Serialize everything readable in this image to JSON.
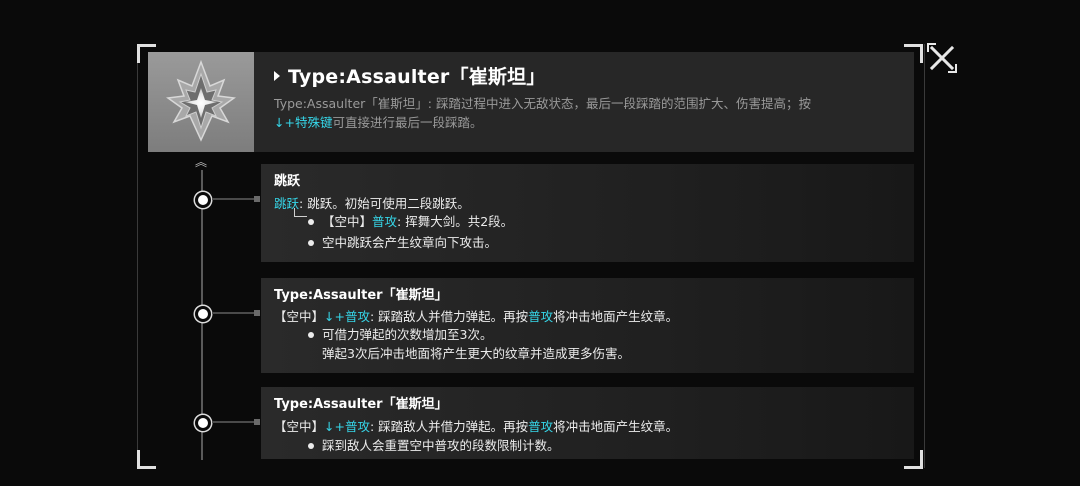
{
  "header": {
    "title": "Type:Assaulter「崔斯坦」",
    "desc_prefix": "Type:Assaulter「崔斯坦」: 踩踏过程中进入无敌状态，最后一段踩踏的范围扩大、伤害提高；按",
    "desc_key": "↓+特殊键",
    "desc_suffix": "可直接进行最后一段踩踏。"
  },
  "cards": [
    {
      "title": "跳跃",
      "line1_key": "跳跃",
      "line1_text": ": 跳跃。初始可使用二段跳跃。",
      "line2_bracket": "【空中】",
      "line2_key": "普攻",
      "line2_text": ": 挥舞大剑。共2段。",
      "line3": "空中跳跃会产生纹章向下攻击。"
    },
    {
      "title": "Type:Assaulter「崔斯坦」",
      "line1_bracket": "【空中】",
      "line1_key": "↓+普攻",
      "line1_text": ": 踩踏敌人并借力弹起。再按",
      "line1_key2": "普攻",
      "line1_text2": "将冲击地面产生纹章。",
      "line2": "可借力弹起的次数增加至3次。",
      "line3": "弹起3次后冲击地面将产生更大的纹章并造成更多伤害。"
    },
    {
      "title": "Type:Assaulter「崔斯坦」",
      "line1_bracket": "【空中】",
      "line1_key": "↓+普攻",
      "line1_text": ": 踩踏敌人并借力弹起。再按",
      "line1_key2": "普攻",
      "line1_text2": "将冲击地面产生纹章。",
      "line2": "踩到敌人会重置空中普攻的段数限制计数。"
    }
  ],
  "icons": {
    "close": "close-icon",
    "emblem": "crystal-emblem-icon",
    "scroll_up": "double-chevron-up-icon"
  },
  "colors": {
    "accent": "#36d6e8",
    "text": "#ececec",
    "muted": "#9a9a9a"
  }
}
